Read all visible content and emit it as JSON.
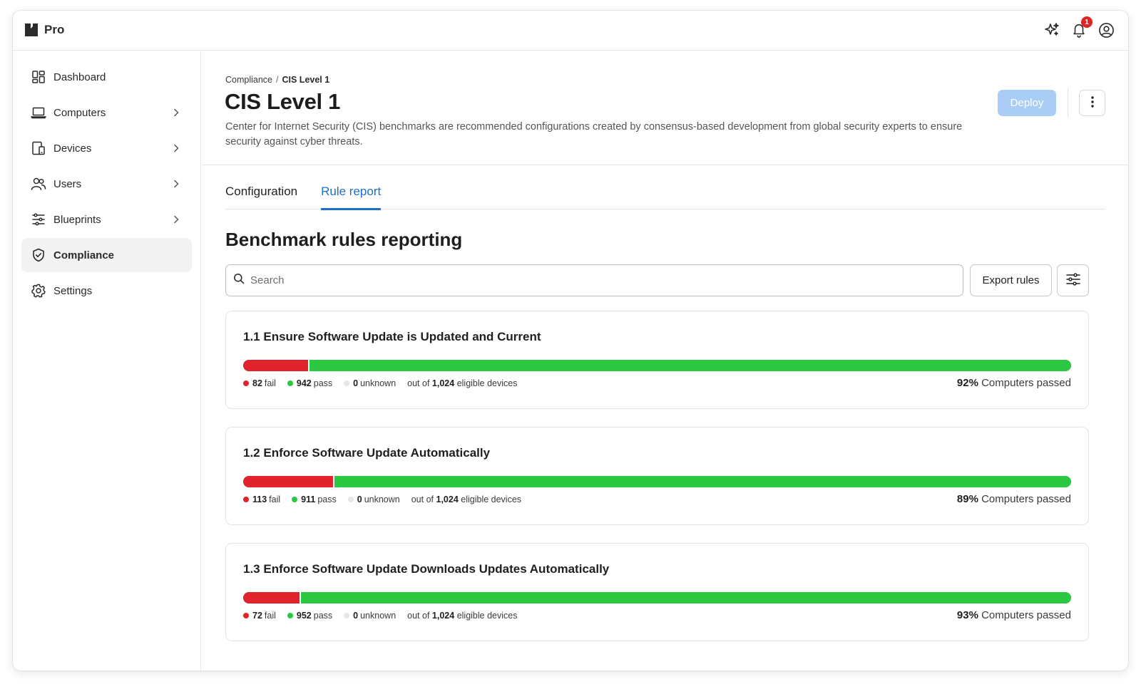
{
  "app": {
    "brand": "Pro",
    "notification_count": "1"
  },
  "sidebar": {
    "items": [
      {
        "label": "Dashboard",
        "icon": "dashboard-icon",
        "has_chevron": false,
        "active": false
      },
      {
        "label": "Computers",
        "icon": "laptop-icon",
        "has_chevron": true,
        "active": false
      },
      {
        "label": "Devices",
        "icon": "devices-icon",
        "has_chevron": true,
        "active": false
      },
      {
        "label": "Users",
        "icon": "users-icon",
        "has_chevron": true,
        "active": false
      },
      {
        "label": "Blueprints",
        "icon": "sliders-icon",
        "has_chevron": true,
        "active": false
      },
      {
        "label": "Compliance",
        "icon": "shield-icon",
        "has_chevron": false,
        "active": true
      },
      {
        "label": "Settings",
        "icon": "gear-icon",
        "has_chevron": false,
        "active": false
      }
    ]
  },
  "header": {
    "breadcrumb": {
      "parent": "Compliance",
      "separator": "/",
      "current": "CIS Level 1"
    },
    "title": "CIS Level 1",
    "description": "Center for Internet Security (CIS) benchmarks are recommended configurations created by consensus-based development from global security experts to ensure security against cyber threats.",
    "deploy_label": "Deploy"
  },
  "tabs": [
    {
      "label": "Configuration",
      "active": false
    },
    {
      "label": "Rule report",
      "active": true
    }
  ],
  "report": {
    "section_title": "Benchmark rules reporting",
    "search_placeholder": "Search",
    "export_label": "Export rules",
    "rules": [
      {
        "title": "1.1 Ensure Software Update is Updated and Current",
        "fail": "82",
        "pass": "942",
        "unknown": "0",
        "eligible": "1,024",
        "passed_percent": "92%",
        "fail_fraction": 0.08
      },
      {
        "title": "1.2 Enforce Software Update Automatically",
        "fail": "113",
        "pass": "911",
        "unknown": "0",
        "eligible": "1,024",
        "passed_percent": "89%",
        "fail_fraction": 0.11
      },
      {
        "title": "1.3 Enforce Software Update Downloads Updates Automatically",
        "fail": "72",
        "pass": "952",
        "unknown": "0",
        "eligible": "1,024",
        "passed_percent": "93%",
        "fail_fraction": 0.07
      }
    ],
    "labels": {
      "fail": "fail",
      "pass": "pass",
      "unknown": "unknown",
      "out_of": "out of",
      "eligible_devices": "eligible devices",
      "computers_passed": "Computers passed"
    }
  },
  "colors": {
    "accent": "#1f6fc9",
    "fail": "#e0232c",
    "pass": "#2cc841",
    "deploy_disabled": "#a9cdf4"
  }
}
